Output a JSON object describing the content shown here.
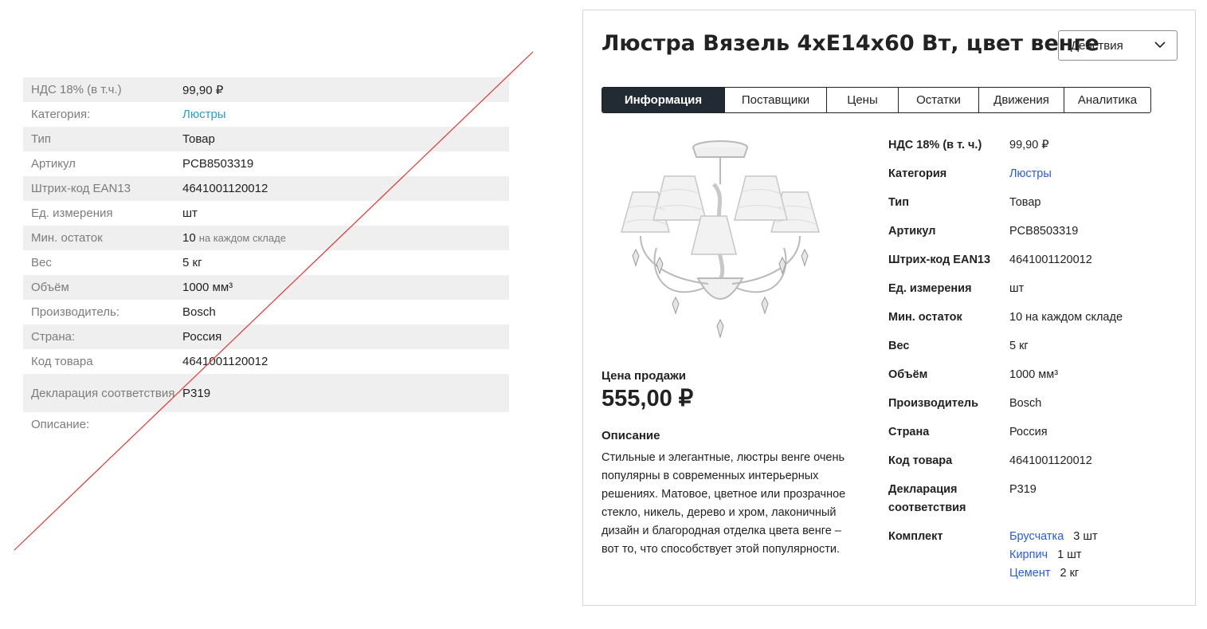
{
  "old_table": {
    "rows": [
      {
        "label": "НДС 18% (в т.ч.)",
        "value": "99,90 ₽"
      },
      {
        "label": "Категория:",
        "value": "Люстры"
      },
      {
        "label": "Тип",
        "value": "Товар"
      },
      {
        "label": "Артикул",
        "value": "PCB8503319"
      },
      {
        "label": "Штрих-код EAN13",
        "value": "4641001120012"
      },
      {
        "label": "Ед. измерения",
        "value": "шт"
      },
      {
        "label": "Мин. остаток",
        "value": "10",
        "note": "на каждом складе"
      },
      {
        "label": "Вес",
        "value": "5 кг"
      },
      {
        "label": "Объём",
        "value": "1000 мм³"
      },
      {
        "label": "Производитель:",
        "value": "Bosch"
      },
      {
        "label": "Страна:",
        "value": "Россия"
      },
      {
        "label": "Код товара",
        "value": "4641001120012"
      },
      {
        "label": "Декларация соответствия",
        "value": "Р319"
      },
      {
        "label": "Описание:",
        "value": ""
      }
    ]
  },
  "card": {
    "title": "Люстра Вязель 4хЕ14х60 Вт, цвет венге",
    "actions_label": "Действия",
    "tabs": [
      "Информация",
      "Поставщики",
      "Цены",
      "Остатки",
      "Движения",
      "Аналитика"
    ],
    "active_tab": "Информация",
    "price_label": "Цена продажи",
    "price": "555,00 ₽",
    "description_heading": "Описание",
    "description": "Стильные и элегантные, люстры венге очень популярны в современных интерьерных решениях. Матовое, цветное или прозрачное стекло, никель, дерево и хром, лаконичный дизайн и благородная отделка цвета венге – вот то, что способствует этой популярности.",
    "properties": [
      {
        "label": "НДС 18% (в т. ч.)",
        "value": "99,90 ₽"
      },
      {
        "label": "Категория",
        "value": "Люстры"
      },
      {
        "label": "Тип",
        "value": "Товар"
      },
      {
        "label": "Артикул",
        "value": "PCB8503319"
      },
      {
        "label": "Штрих-код EAN13",
        "value": "4641001120012"
      },
      {
        "label": "Ед. измерения",
        "value": "шт"
      },
      {
        "label": "Мин. остаток",
        "value": "10 на каждом складе"
      },
      {
        "label": "Вес",
        "value": "5 кг"
      },
      {
        "label": "Объём",
        "value": "1000 мм³"
      },
      {
        "label": "Производитель",
        "value": "Bosch"
      },
      {
        "label": "Страна",
        "value": "Россия"
      },
      {
        "label": "Код товара",
        "value": "4641001120012"
      },
      {
        "label": "Декларация соответствия",
        "value": "Р319"
      }
    ],
    "kit_label": "Комплект",
    "kit": [
      {
        "name": "Брусчатка",
        "qty": "3 шт"
      },
      {
        "name": "Кирпич",
        "qty": "1 шт"
      },
      {
        "name": "Цемент",
        "qty": "2 кг"
      }
    ]
  },
  "colors": {
    "link_old": "#2a9bc4",
    "link_new": "#2a5bd7",
    "active_tab": "#222b33",
    "strike": "#e33333"
  },
  "icons": {
    "actions_chevron": "chevron-down-icon",
    "product": "chandelier-image"
  }
}
